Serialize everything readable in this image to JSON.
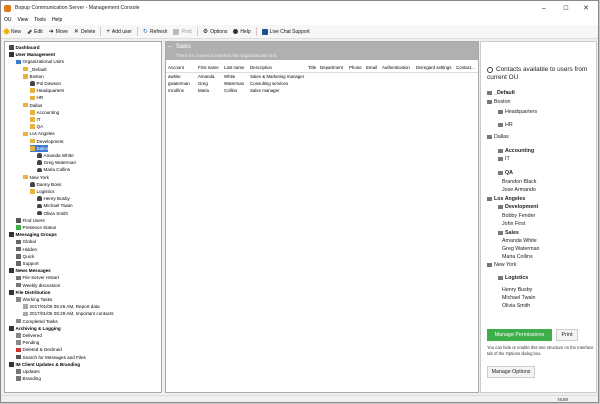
{
  "window": {
    "title": "Bopup Communication Server - Management Console",
    "minimize": "–",
    "maximize": "☐",
    "close": "✕"
  },
  "menu": [
    "OU",
    "View",
    "Tools",
    "Help"
  ],
  "toolbar": {
    "new": "New",
    "edit": "Edit",
    "move": "Move",
    "delete": "Delete",
    "add_user": "Add user",
    "refresh": "Refresh",
    "print": "Print",
    "options": "Options",
    "help": "Help",
    "live_chat": "Live Chat Support"
  },
  "tree": [
    {
      "label": "Dashboard",
      "level": 0,
      "bold": true,
      "icon": "dashboard-icon"
    },
    {
      "label": "User Management",
      "level": 0,
      "bold": true,
      "icon": "users-icon"
    },
    {
      "label": "Organizational Units",
      "level": 1,
      "icon": "ou-icon"
    },
    {
      "label": "_Default",
      "level": 2,
      "icon": "folder-icon"
    },
    {
      "label": "Boston",
      "level": 2,
      "icon": "folder-icon"
    },
    {
      "label": "Pol Dowson",
      "level": 3,
      "icon": "user-icon"
    },
    {
      "label": "Headquarters",
      "level": 3,
      "icon": "folder-icon"
    },
    {
      "label": "HR",
      "level": 3,
      "icon": "folder-icon"
    },
    {
      "label": "Dallas",
      "level": 2,
      "icon": "folder-icon"
    },
    {
      "label": "Accounting",
      "level": 3,
      "icon": "folder-icon"
    },
    {
      "label": "IT",
      "level": 3,
      "icon": "folder-icon"
    },
    {
      "label": "QA",
      "level": 3,
      "icon": "folder-icon"
    },
    {
      "label": "Los Angeles",
      "level": 2,
      "icon": "folder-icon"
    },
    {
      "label": "Development",
      "level": 3,
      "icon": "folder-icon"
    },
    {
      "label": "Sales",
      "level": 3,
      "icon": "folder-icon",
      "selected": true
    },
    {
      "label": "Amanda White",
      "level": 4,
      "icon": "user-icon"
    },
    {
      "label": "Greg Waterman",
      "level": 4,
      "icon": "user-icon"
    },
    {
      "label": "Maria Collins",
      "level": 4,
      "icon": "user-icon"
    },
    {
      "label": "New York",
      "level": 2,
      "icon": "folder-icon"
    },
    {
      "label": "Danny Boss",
      "level": 3,
      "icon": "user-icon"
    },
    {
      "label": "Logistics",
      "level": 3,
      "icon": "folder-icon"
    },
    {
      "label": "Henry Busby",
      "level": 4,
      "icon": "user-icon"
    },
    {
      "label": "Michael Twain",
      "level": 4,
      "icon": "user-icon"
    },
    {
      "label": "Olivia Smith",
      "level": 4,
      "icon": "user-icon"
    },
    {
      "label": "Find Users",
      "level": 1,
      "icon": "search-icon"
    },
    {
      "label": "Presence Status",
      "level": 1,
      "icon": "presence-icon"
    },
    {
      "label": "Messaging Groups",
      "level": 0,
      "bold": true,
      "icon": "groups-icon"
    },
    {
      "label": "Global",
      "level": 1,
      "icon": "group-icon"
    },
    {
      "label": "Hidden",
      "level": 1,
      "icon": "group-icon"
    },
    {
      "label": "Quick",
      "level": 1,
      "icon": "group-icon"
    },
    {
      "label": "Support",
      "level": 1,
      "icon": "group-icon"
    },
    {
      "label": "News Messages",
      "level": 0,
      "bold": true,
      "icon": "news-icon"
    },
    {
      "label": "File Server restart",
      "level": 1,
      "icon": "message-icon"
    },
    {
      "label": "Weekly discussion",
      "level": 1,
      "icon": "message-icon"
    },
    {
      "label": "File Distribution",
      "level": 0,
      "bold": true,
      "icon": "file-distribution-icon"
    },
    {
      "label": "Working Tasks",
      "level": 1,
      "icon": "tasks-icon"
    },
    {
      "label": "2017/01/05 05:26 AM, Report data",
      "level": 2,
      "icon": "task-icon"
    },
    {
      "label": "2017/01/05 05:28 AM, Important contacts",
      "level": 2,
      "icon": "task-icon"
    },
    {
      "label": "Completed Tasks",
      "level": 1,
      "icon": "tasks-icon"
    },
    {
      "label": "Archiving & Logging",
      "level": 0,
      "bold": true,
      "icon": "archive-icon"
    },
    {
      "label": "Delivered",
      "level": 1,
      "icon": "delivered-icon"
    },
    {
      "label": "Pending",
      "level": 1,
      "icon": "pending-icon"
    },
    {
      "label": "Deleted & Declined",
      "level": 1,
      "icon": "deleted-icon"
    },
    {
      "label": "Search for Messages and Files",
      "level": 1,
      "icon": "search-icon"
    },
    {
      "label": "IM Client Updates & Branding",
      "level": 0,
      "bold": true,
      "icon": "updates-icon"
    },
    {
      "label": "Updates",
      "level": 1,
      "icon": "update-icon"
    },
    {
      "label": "Branding",
      "level": 1,
      "icon": "branding-icon"
    }
  ],
  "ou_header": {
    "title": "Sales",
    "subtitle": "There are 3 users accounts in this Organizational Unit."
  },
  "table": {
    "columns": [
      "Account",
      "First name",
      "Last name",
      "Description",
      "Title",
      "Department",
      "Phone",
      "Email",
      "Authentication",
      "Disregard settings",
      "Contact..."
    ],
    "rows": [
      [
        "awhite",
        "Amanda",
        "White",
        "Sales & Marketing manager",
        "",
        "",
        "",
        "",
        "",
        "",
        ""
      ],
      [
        "gwaterman",
        "Greg",
        "Waterman",
        "Consulting services",
        "",
        "",
        "",
        "",
        "",
        "",
        ""
      ],
      [
        "mcollins",
        "Maria",
        "Collins",
        "Sales manager",
        "",
        "",
        "",
        "",
        "",
        "",
        ""
      ]
    ]
  },
  "contacts_panel": {
    "title": "Contacts available to users from current OU",
    "items": [
      {
        "label": "_Default",
        "bold": true,
        "icon": true
      },
      {
        "label": "Boston",
        "bold": false,
        "icon": true
      },
      {
        "label": "Headquarters",
        "bold": false,
        "icon": true
      },
      {
        "label": "HR",
        "bold": false,
        "icon": true
      },
      {
        "label": "Dallas",
        "bold": false,
        "icon": true
      },
      {
        "label": "Accounting",
        "bold": true,
        "icon": true
      },
      {
        "label": "IT",
        "bold": false,
        "icon": true
      },
      {
        "label": "QA",
        "bold": true,
        "icon": true
      },
      {
        "label": "Brandon Black",
        "bold": false,
        "icon": false
      },
      {
        "label": "Jose Armando",
        "bold": false,
        "icon": false
      },
      {
        "label": "Los Angeles",
        "bold": true,
        "icon": true
      },
      {
        "label": "Development",
        "bold": true,
        "icon": true
      },
      {
        "label": "Bobby Fender",
        "bold": false,
        "icon": false
      },
      {
        "label": "John First",
        "bold": false,
        "icon": false
      },
      {
        "label": "Sales",
        "bold": true,
        "icon": true
      },
      {
        "label": "Amanda White",
        "bold": false,
        "icon": false
      },
      {
        "label": "Greg Waterman",
        "bold": false,
        "icon": false
      },
      {
        "label": "Maria Collins",
        "bold": false,
        "icon": false
      },
      {
        "label": "New York",
        "bold": false,
        "icon": true
      },
      {
        "label": "Logistics",
        "bold": true,
        "icon": true
      },
      {
        "label": "Henry Busby",
        "bold": false,
        "icon": false
      },
      {
        "label": "Michael Twain",
        "bold": false,
        "icon": false
      },
      {
        "label": "Olivia Smith",
        "bold": false,
        "icon": false
      }
    ],
    "manage_permissions": "Manage Permissions",
    "print": "Print",
    "note": "You can hide or enable this tree structure on the Interface tab of the Options dialog box.",
    "manage_options": "Manage Options"
  },
  "status": {
    "num": "NUM"
  },
  "colors": {
    "accent_green": "#3dae49",
    "selection_blue": "#3b7bd4",
    "header_grey": "#b0b0b0"
  }
}
